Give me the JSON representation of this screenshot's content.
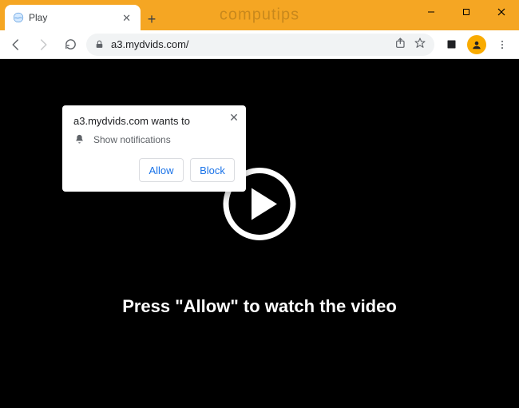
{
  "window": {
    "watermark": "computips"
  },
  "tab": {
    "title": "Play"
  },
  "toolbar": {
    "url": "a3.mydvids.com/"
  },
  "popup": {
    "title": "a3.mydvids.com wants to",
    "permission_label": "Show notifications",
    "allow_label": "Allow",
    "block_label": "Block"
  },
  "page": {
    "caption": "Press \"Allow\" to watch the video"
  }
}
